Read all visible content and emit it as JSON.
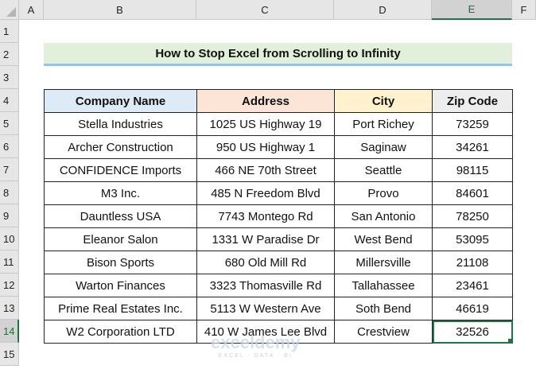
{
  "columns": [
    "A",
    "B",
    "C",
    "D",
    "E",
    "F"
  ],
  "rows": [
    "1",
    "2",
    "3",
    "4",
    "5",
    "6",
    "7",
    "8",
    "9",
    "10",
    "11",
    "12",
    "13",
    "14",
    "15"
  ],
  "title": "How to Stop Excel from Scrolling to Infinity",
  "table": {
    "headers": [
      "Company Name",
      "Address",
      "City",
      "Zip Code"
    ],
    "header_colors": [
      "#ddebf7",
      "#fce4d6",
      "#fff2cc",
      "#ededed"
    ],
    "rows": [
      [
        "Stella Industries",
        "1025 US Highway 19",
        "Port Richey",
        "73259"
      ],
      [
        "Archer Construction",
        "950 US Highway 1",
        "Saginaw",
        "34261"
      ],
      [
        "CONFIDENCE Imports",
        "466 NE 70th Street",
        "Seattle",
        "98115"
      ],
      [
        "M3 Inc.",
        "485 N Freedom Blvd",
        "Provo",
        "84601"
      ],
      [
        "Dauntless USA",
        "7743 Montego Rd",
        "San Antonio",
        "78250"
      ],
      [
        "Eleanor Salon",
        "1331 W Paradise Dr",
        "West Bend",
        "53095"
      ],
      [
        "Bison Sports",
        "680 Old Mill Rd",
        "Millersville",
        "21108"
      ],
      [
        "Warton Finances",
        "3323 Thomasville Rd",
        "Tallahassee",
        "23461"
      ],
      [
        "Prime Real Estates Inc.",
        "5113 W Western Ave",
        "Soth Bend",
        "46619"
      ],
      [
        "W2 Corporation LTD",
        "410 W James Lee Blvd",
        "Crestview",
        "32526"
      ]
    ]
  },
  "watermark": {
    "name": "exceldemy",
    "tagline": "EXCEL · DATA · BI"
  }
}
